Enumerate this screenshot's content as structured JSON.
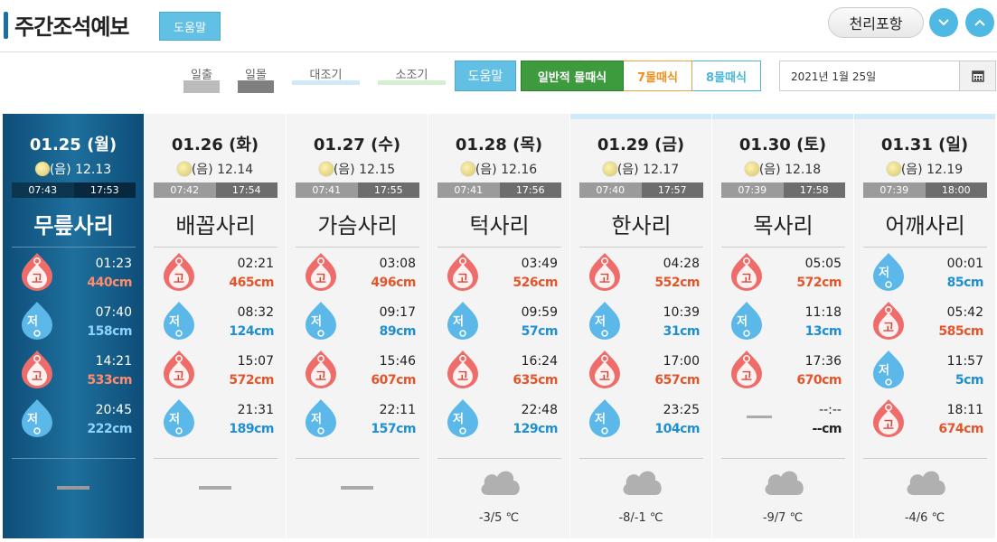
{
  "header": {
    "title": "주간조석예보",
    "help_label": "도움말",
    "location": "천리포항"
  },
  "legend": {
    "sunrise": "일출",
    "sunset": "일몰",
    "spring_tide": "대조기",
    "neap_tide": "소조기"
  },
  "controls": {
    "help_label": "도움말",
    "mode_general": "일반적 물때식",
    "mode_7": "7물때식",
    "mode_8": "8물때식",
    "date": "2021년 1월 25일"
  },
  "colors": {
    "accent": "#62c0e4",
    "high_tide": "#e3562c",
    "low_tide": "#1e8fd0",
    "general_mode": "#3d9a3d",
    "mode_7": "#f0901e"
  },
  "icons": {
    "high": "high-tide-drop-icon",
    "low": "low-tide-drop-icon",
    "weather": "cloud-icon",
    "calendar": "calendar-icon"
  },
  "drop_labels": {
    "high": "고",
    "low": "저"
  },
  "days": [
    {
      "date": "01.25 (월)",
      "lunar": "(음) 12.13",
      "sunrise": "07:43",
      "sunset": "17:53",
      "mulddae": "무릎사리",
      "tides": [
        {
          "type": "high",
          "time": "01:23",
          "level": "440cm"
        },
        {
          "type": "low",
          "time": "07:40",
          "level": "158cm"
        },
        {
          "type": "high",
          "time": "14:21",
          "level": "533cm"
        },
        {
          "type": "low",
          "time": "20:45",
          "level": "222cm"
        }
      ],
      "weather": null,
      "temp": ""
    },
    {
      "date": "01.26 (화)",
      "lunar": "(음) 12.14",
      "sunrise": "07:42",
      "sunset": "17:54",
      "mulddae": "배꼽사리",
      "tides": [
        {
          "type": "high",
          "time": "02:21",
          "level": "465cm"
        },
        {
          "type": "low",
          "time": "08:32",
          "level": "124cm"
        },
        {
          "type": "high",
          "time": "15:07",
          "level": "572cm"
        },
        {
          "type": "low",
          "time": "21:31",
          "level": "189cm"
        }
      ],
      "weather": null,
      "temp": ""
    },
    {
      "date": "01.27 (수)",
      "lunar": "(음) 12.15",
      "sunrise": "07:41",
      "sunset": "17:55",
      "mulddae": "가슴사리",
      "tides": [
        {
          "type": "high",
          "time": "03:08",
          "level": "496cm"
        },
        {
          "type": "low",
          "time": "09:17",
          "level": "89cm"
        },
        {
          "type": "high",
          "time": "15:46",
          "level": "607cm"
        },
        {
          "type": "low",
          "time": "22:11",
          "level": "157cm"
        }
      ],
      "weather": null,
      "temp": ""
    },
    {
      "date": "01.28 (목)",
      "lunar": "(음) 12.16",
      "sunrise": "07:41",
      "sunset": "17:56",
      "mulddae": "턱사리",
      "tides": [
        {
          "type": "high",
          "time": "03:49",
          "level": "526cm"
        },
        {
          "type": "low",
          "time": "09:59",
          "level": "57cm"
        },
        {
          "type": "high",
          "time": "16:24",
          "level": "635cm"
        },
        {
          "type": "low",
          "time": "22:48",
          "level": "129cm"
        }
      ],
      "weather": "cloud",
      "temp": "-3/5 ℃"
    },
    {
      "date": "01.29 (금)",
      "lunar": "(음) 12.17",
      "sunrise": "07:40",
      "sunset": "17:57",
      "mulddae": "한사리",
      "tides": [
        {
          "type": "high",
          "time": "04:28",
          "level": "552cm"
        },
        {
          "type": "low",
          "time": "10:39",
          "level": "31cm"
        },
        {
          "type": "high",
          "time": "17:00",
          "level": "657cm"
        },
        {
          "type": "low",
          "time": "23:25",
          "level": "104cm"
        }
      ],
      "weather": "cloud",
      "temp": "-8/-1 ℃"
    },
    {
      "date": "01.30 (토)",
      "lunar": "(음) 12.18",
      "sunrise": "07:39",
      "sunset": "17:58",
      "mulddae": "목사리",
      "tides": [
        {
          "type": "high",
          "time": "05:05",
          "level": "572cm"
        },
        {
          "type": "low",
          "time": "11:18",
          "level": "13cm"
        },
        {
          "type": "high",
          "time": "17:36",
          "level": "670cm"
        },
        {
          "type": "none",
          "time": "--:--",
          "level": "--cm"
        }
      ],
      "weather": "cloud",
      "temp": "-9/7 ℃"
    },
    {
      "date": "01.31 (일)",
      "lunar": "(음) 12.19",
      "sunrise": "07:39",
      "sunset": "18:00",
      "mulddae": "어깨사리",
      "tides": [
        {
          "type": "low",
          "time": "00:01",
          "level": "85cm"
        },
        {
          "type": "high",
          "time": "05:42",
          "level": "585cm"
        },
        {
          "type": "low",
          "time": "11:57",
          "level": "5cm"
        },
        {
          "type": "high",
          "time": "18:11",
          "level": "674cm"
        }
      ],
      "weather": "cloud",
      "temp": "-4/6 ℃"
    }
  ]
}
